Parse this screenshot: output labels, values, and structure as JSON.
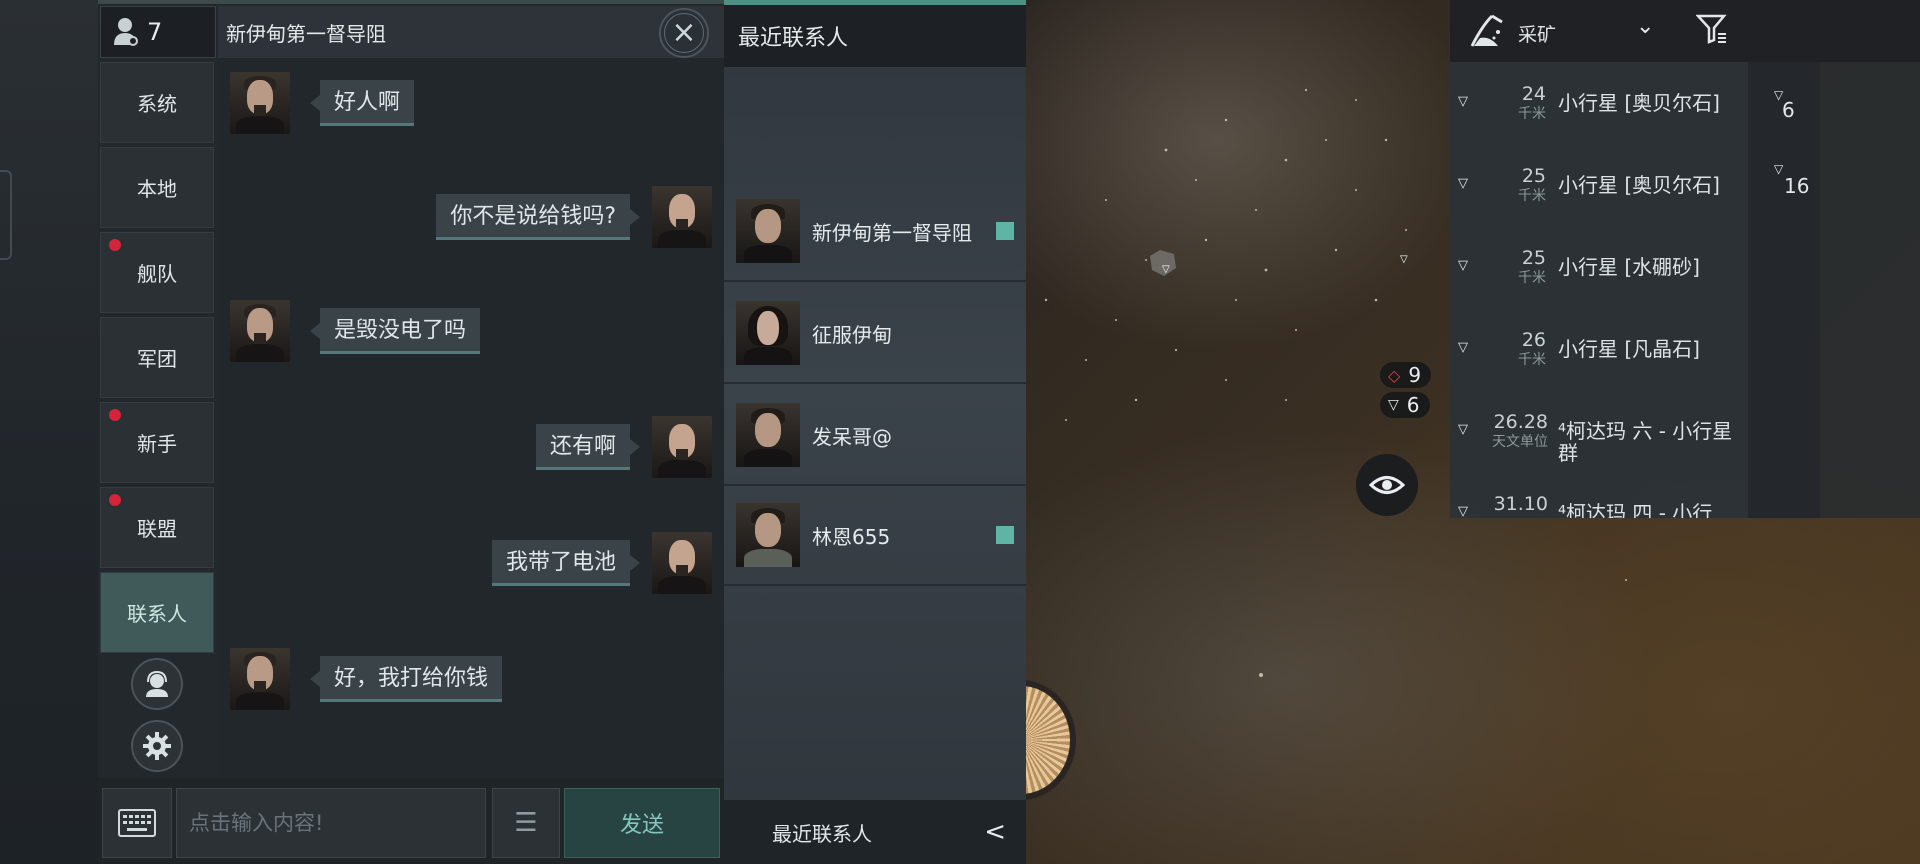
{
  "chat": {
    "member_count": "7",
    "title": "新伊甸第一督导阻",
    "channels": [
      {
        "label": "系统",
        "unread": false
      },
      {
        "label": "本地",
        "unread": false
      },
      {
        "label": "舰队",
        "unread": true
      },
      {
        "label": "军团",
        "unread": false
      },
      {
        "label": "新手",
        "unread": true
      },
      {
        "label": "联盟",
        "unread": true
      },
      {
        "label": "联系人",
        "unread": false,
        "active": true
      }
    ],
    "messages": [
      {
        "side": "left",
        "text": "好人啊"
      },
      {
        "side": "right",
        "text": "你不是说给钱吗?"
      },
      {
        "side": "left",
        "text": "是毁没电了吗"
      },
      {
        "side": "right",
        "text": "还有啊"
      },
      {
        "side": "right",
        "text": "我带了电池"
      },
      {
        "side": "left",
        "text": "好，我打给你钱"
      }
    ],
    "input_placeholder": "点击输入内容!",
    "send_label": "发送"
  },
  "contacts": {
    "header": "最近联系人",
    "items": [
      {
        "name": "新伊甸第一督导阻",
        "online": true
      },
      {
        "name": "征服伊甸",
        "online": false
      },
      {
        "name": "发呆哥@",
        "online": false
      },
      {
        "name": "林恩655",
        "online": true
      }
    ],
    "footer": "最近联系人"
  },
  "overview": {
    "filter_label": "采矿",
    "rows": [
      {
        "distance": "24",
        "unit": "千米",
        "name": "小行星 [奥贝尔石]"
      },
      {
        "distance": "25",
        "unit": "千米",
        "name": "小行星 [奥贝尔石]"
      },
      {
        "distance": "25",
        "unit": "千米",
        "name": "小行星 [水硼砂]"
      },
      {
        "distance": "26",
        "unit": "千米",
        "name": "小行星 [凡晶石]"
      },
      {
        "distance": "26.28",
        "unit": "天文单位",
        "name": "⁴柯达玛 六 - 小行星群"
      },
      {
        "distance": "31.10",
        "unit": "",
        "name": "⁴柯达玛 四 - 小行"
      }
    ],
    "side_counts": [
      "6",
      "16"
    ]
  },
  "hud": {
    "hostile_count": "9",
    "asteroid_count": "6"
  },
  "colors": {
    "accent": "#5fb5a5",
    "unread_dot": "#d3243a",
    "active_tab": "#3f5a58"
  }
}
